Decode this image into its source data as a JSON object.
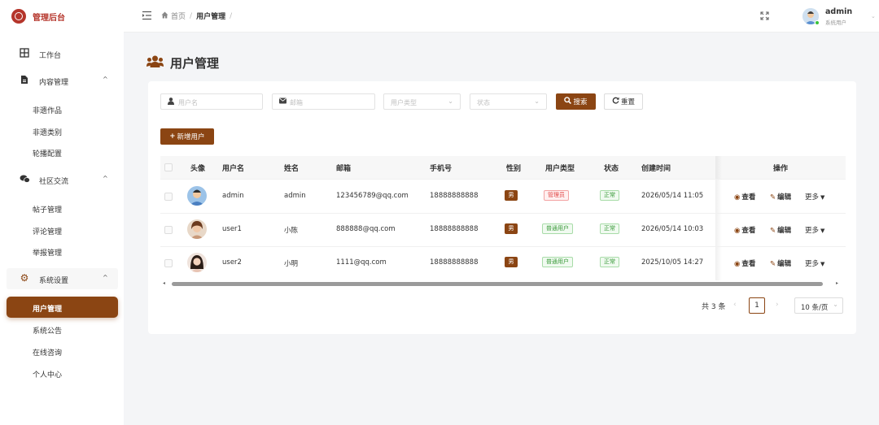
{
  "app": {
    "title": "管理后台"
  },
  "sidebar": {
    "items": [
      {
        "label": "工作台"
      },
      {
        "label": "内容管理",
        "children": [
          "非遗作品",
          "非遗类别",
          "轮播配置"
        ]
      },
      {
        "label": "社区交流",
        "children": [
          "帖子管理",
          "评论管理",
          "举报管理"
        ]
      },
      {
        "label": "系统设置",
        "children": [
          "用户管理",
          "系统公告",
          "在线咨询",
          "个人中心"
        ]
      }
    ]
  },
  "topbar": {
    "breadcrumb": {
      "home": "首页",
      "current": "用户管理",
      "sep": "/"
    },
    "user": {
      "name": "admin",
      "role": "系统用户"
    }
  },
  "page": {
    "title": "用户管理"
  },
  "filters": {
    "username_placeholder": "用户名",
    "email_placeholder": "邮箱",
    "user_type_placeholder": "用户类型",
    "status_placeholder": "状态",
    "search_label": "搜索",
    "reset_label": "重置"
  },
  "toolbar": {
    "add_label": "新增用户"
  },
  "table": {
    "columns": [
      "头像",
      "用户名",
      "姓名",
      "邮箱",
      "手机号",
      "性别",
      "用户类型",
      "状态",
      "创建时间",
      "操作"
    ],
    "rows": [
      {
        "username": "admin",
        "name": "admin",
        "email": "123456789@qq.com",
        "phone": "18888888888",
        "gender": "男",
        "user_type": "管理员",
        "status": "正常",
        "created": "2026/05/14 11:05"
      },
      {
        "username": "user1",
        "name": "小陈",
        "email": "888888@qq.com",
        "phone": "18888888888",
        "gender": "男",
        "user_type": "普通用户",
        "status": "正常",
        "created": "2026/05/14 10:03"
      },
      {
        "username": "user2",
        "name": "小明",
        "email": "1111@qq.com",
        "phone": "18888888888",
        "gender": "男",
        "user_type": "普通用户",
        "status": "正常",
        "created": "2025/10/05 14:27"
      }
    ],
    "actions": {
      "view": "查看",
      "edit": "编辑",
      "more": "更多"
    }
  },
  "pagination": {
    "total": "共 3 条",
    "current_page": "1",
    "page_size": "10 条/页"
  },
  "colors": {
    "brand": "#8b4513",
    "logo": "#b5352b",
    "danger": "#e04444",
    "success": "#3a9a3a"
  }
}
